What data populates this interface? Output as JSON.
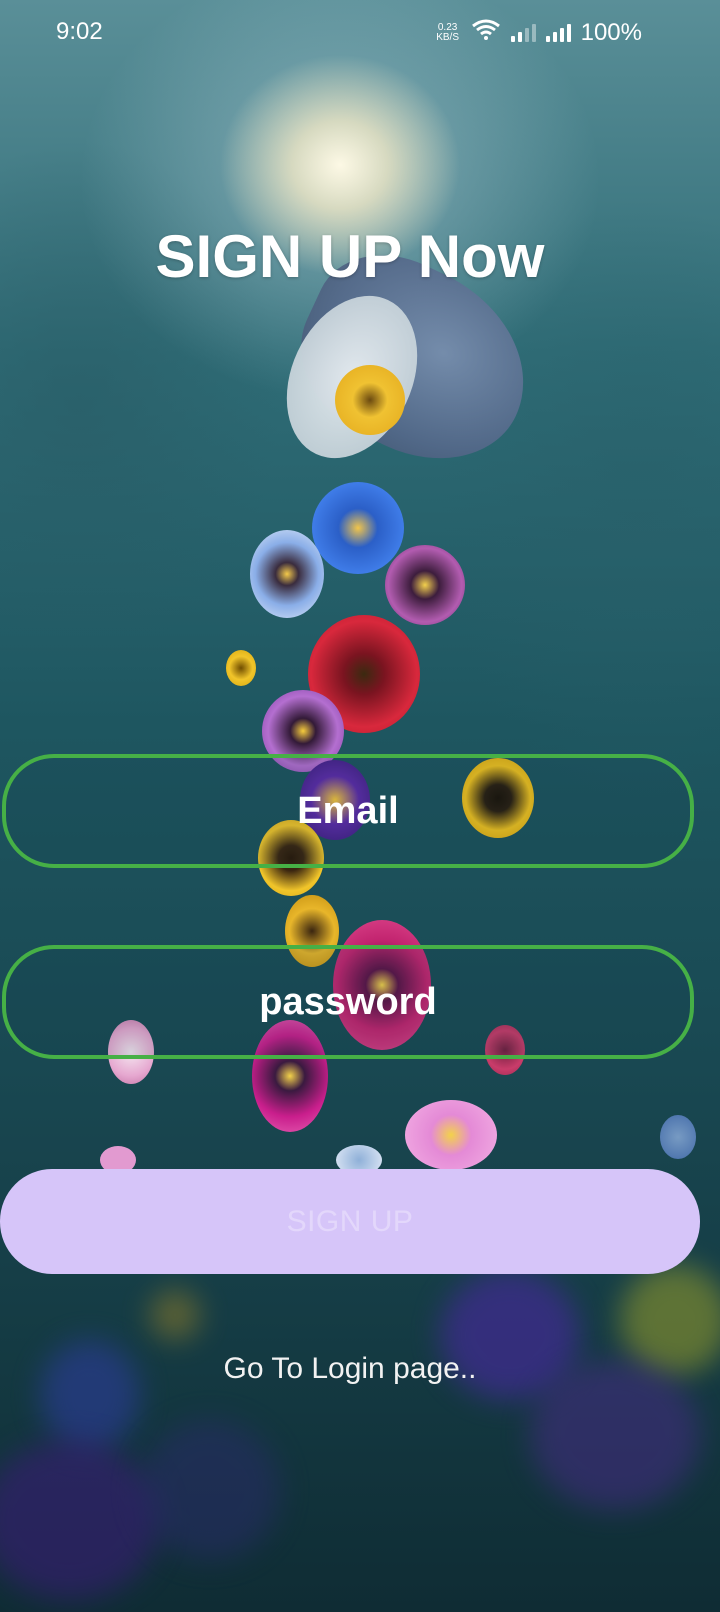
{
  "status_bar": {
    "time": "9:02",
    "net_speed_value": "0.23",
    "net_speed_unit": "KB/S",
    "battery": "100%"
  },
  "form": {
    "title": "SIGN UP Now",
    "email_placeholder": "Email",
    "password_placeholder": "password",
    "signup_label": "SIGN UP",
    "login_link": "Go To Login page.."
  },
  "colors": {
    "field_border": "#46b046",
    "button_bg": "#d6c5f9",
    "button_text": "#e3d7fb"
  }
}
